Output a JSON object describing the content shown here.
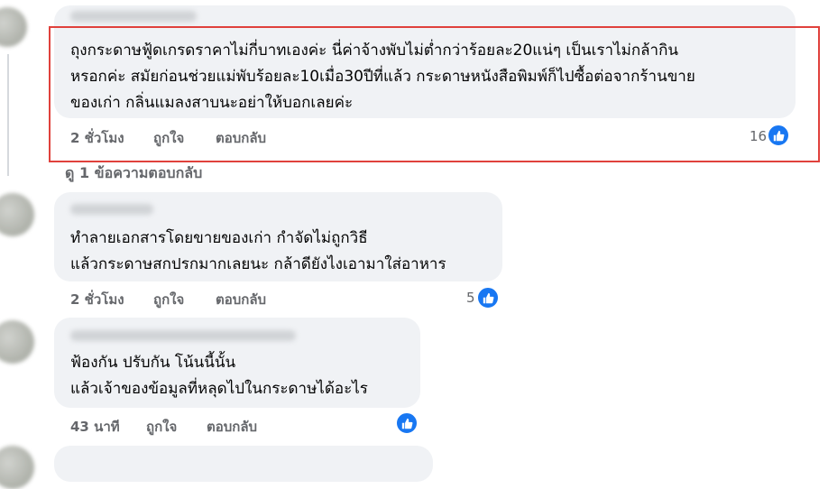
{
  "comments": [
    {
      "text_lines": [
        "ถุงกระดาษฟู้ดเกรดราคาไม่กี่บาทเองค่ะ นี่ค่าจ้างพับไม่ต่ำกว่าร้อยละ20แน่ๆ เป็นเราไม่กล้ากิน",
        "หรอกค่ะ สมัยก่อนช่วยแม่พับร้อยละ10เมื่อ30ปีที่แล้ว กระดาษหนังสือพิมพ์ก็ไปซื้อต่อจากร้านขาย",
        "ของเก่า กลิ่นแมลงสาบนะอย่าให้บอกเลยค่ะ"
      ],
      "time": "2 ชั่วโมง",
      "like_label": "ถูกใจ",
      "reply_label": "ตอบกลับ",
      "reaction_count": "16"
    },
    {
      "text_lines": [
        "ทำลายเอกสารโดยขายของเก่า กำจัดไม่ถูกวิธี",
        "แล้วกระดาษสกปรกมากเลยนะ กล้าดียังไงเอามาใส่อาหาร"
      ],
      "time": "2 ชั่วโมง",
      "like_label": "ถูกใจ",
      "reply_label": "ตอบกลับ",
      "reaction_count": "5"
    },
    {
      "text_lines": [
        "ฟ้องกัน ปรับกัน โน้นนี้นั้น",
        "แล้วเจ้าของข้อมูลที่หลุดไปในกระดาษได้อะไร"
      ],
      "time": "43 นาที",
      "like_label": "ถูกใจ",
      "reply_label": "ตอบกลับ",
      "reaction_count": ""
    }
  ],
  "view_replies_label": "ดู 1 ข้อความตอบกลับ",
  "colors": {
    "bubble": "#f0f2f5",
    "secondary_text": "#65676b",
    "like_blue": "#1877f2",
    "highlight_red": "#e0413c"
  },
  "icons": {
    "reaction": "thumbs-up-icon"
  }
}
